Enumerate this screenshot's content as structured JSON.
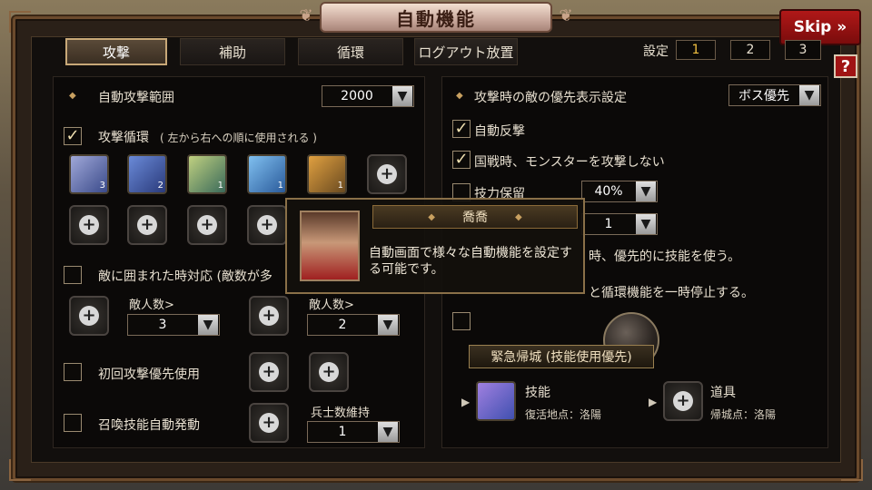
{
  "window": {
    "title": "自動機能",
    "skip_label": "Skip »",
    "help_label": "?"
  },
  "tabs": [
    {
      "label": "攻撃",
      "active": true
    },
    {
      "label": "補助",
      "active": false
    },
    {
      "label": "循環",
      "active": false
    },
    {
      "label": "ログアウト放置",
      "active": false
    }
  ],
  "settings": {
    "label": "設定",
    "slots": [
      "1",
      "2",
      "3"
    ],
    "selected": "1"
  },
  "left": {
    "attack_range": {
      "label": "自動攻撃範囲",
      "value": "2000"
    },
    "attack_cycle": {
      "checked": true,
      "label": "攻撃循環",
      "note": "( 左から右への順に使用される )"
    },
    "skills": [
      {
        "name": "skill-1",
        "level": "3",
        "color": "#3a4a8a"
      },
      {
        "name": "skill-2",
        "level": "2",
        "color": "#2a3a7a"
      },
      {
        "name": "skill-3",
        "level": "1",
        "color": "#3a6a5a"
      },
      {
        "name": "skill-4",
        "level": "1",
        "color": "#2a5a9a"
      },
      {
        "name": "skill-5",
        "level": "1",
        "color": "#6a4a20"
      }
    ],
    "surrounded": {
      "checked": false,
      "label": "敵に囲まれた時対応 (敵数が多",
      "groups": [
        {
          "label": "敵人数>",
          "value": "3"
        },
        {
          "label": "敵人数>",
          "value": "2"
        }
      ]
    },
    "first_attack": {
      "checked": false,
      "label": "初回攻撃優先使用"
    },
    "summon": {
      "checked": false,
      "label": "召喚技能自動発動",
      "sub_label": "兵士数維持",
      "value": "1"
    }
  },
  "right": {
    "priority": {
      "label": "攻撃時の敵の優先表示設定",
      "value": "ボス優先"
    },
    "auto_counter": {
      "checked": true,
      "label": "自動反撃"
    },
    "no_monster": {
      "checked": true,
      "label": "国戦時、モンスターを攻撃しない"
    },
    "reserve": {
      "checked": false,
      "label": "技力保留",
      "value": "40%"
    },
    "line4_value": "1",
    "line5_text": "時、優先的に技能を使う。",
    "line6_text": "と循環機能を一時停止する。",
    "emergency": {
      "title": "緊急帰城 (技能使用優先)",
      "skill": {
        "label": "技能",
        "sub": "復活地点：洛陽"
      },
      "item": {
        "label": "道具",
        "sub": "帰城点：洛陽"
      }
    }
  },
  "tooltip": {
    "name": "喬喬",
    "text": "自動画面で様々な自動機能を設定する可能です。"
  }
}
